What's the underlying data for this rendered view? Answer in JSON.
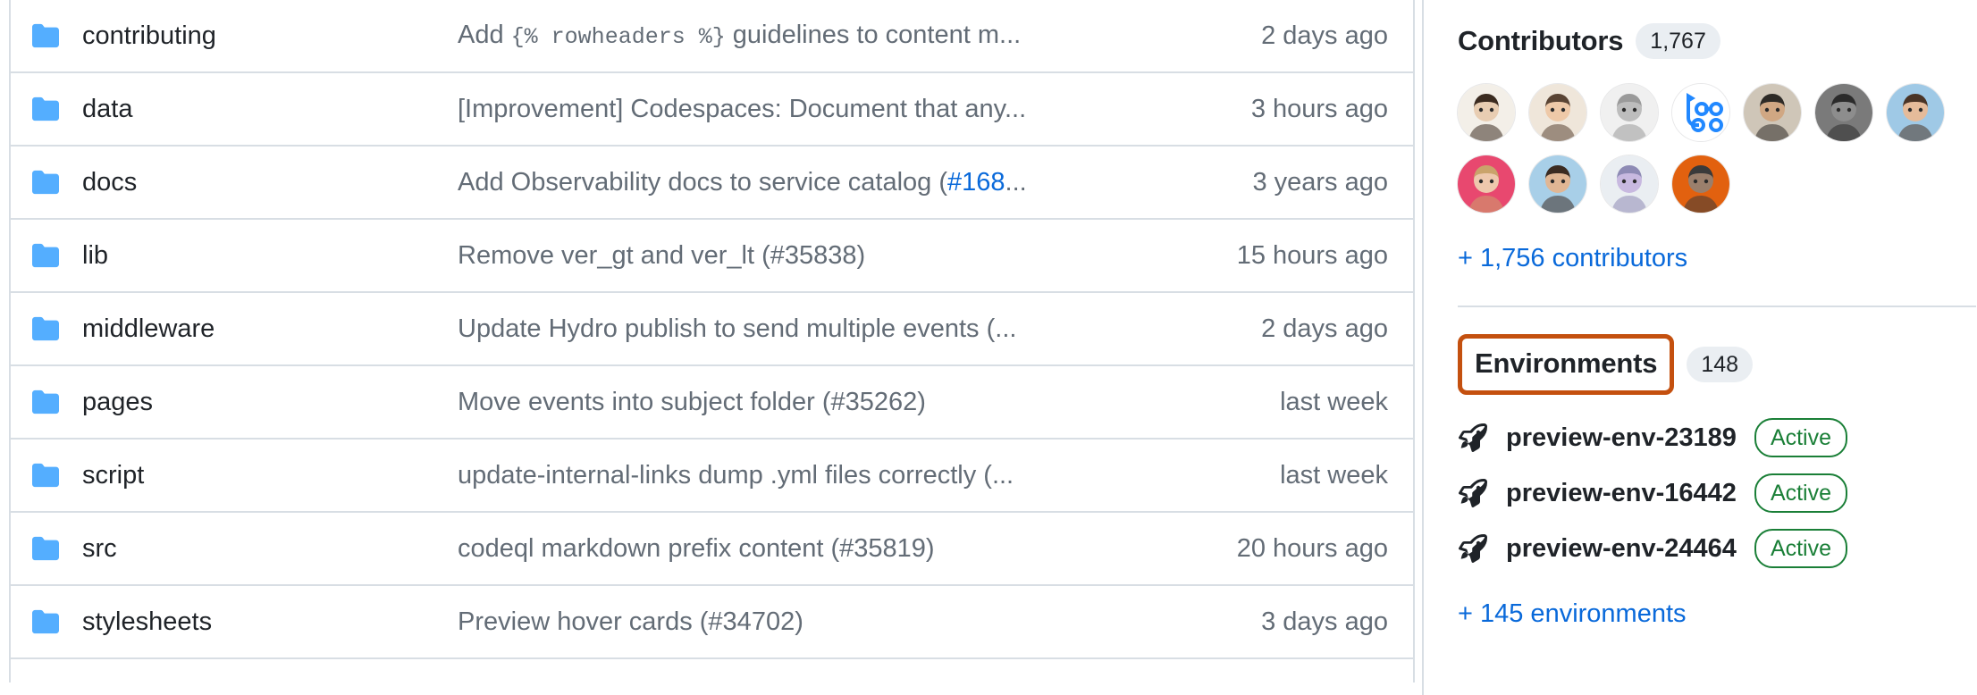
{
  "file_table": {
    "folder_icon_color": "#54aeff",
    "link_color": "#0969da",
    "rows": [
      {
        "name": "contributing",
        "icon": "folder-icon",
        "commit_pre": "Add ",
        "commit_code": "{% rowheaders %}",
        "commit_post": " guidelines to content m",
        "commit_link": "",
        "commit_tail": "",
        "truncated": "...",
        "date": "2 days ago"
      },
      {
        "name": "data",
        "icon": "folder-icon",
        "commit_pre": "[Improvement] Codespaces: Document that any",
        "commit_code": "",
        "commit_post": "",
        "commit_link": "",
        "commit_tail": "",
        "truncated": "...",
        "date": "3 hours ago"
      },
      {
        "name": "docs",
        "icon": "folder-icon",
        "commit_pre": "Add Observability docs to service catalog (",
        "commit_code": "",
        "commit_post": "",
        "commit_link": "#168",
        "commit_tail": "",
        "truncated": "...",
        "date": "3 years ago"
      },
      {
        "name": "lib",
        "icon": "folder-icon",
        "commit_pre": "Remove ver_gt and ver_lt (#35838)",
        "commit_code": "",
        "commit_post": "",
        "commit_link": "",
        "commit_tail": "",
        "truncated": "",
        "date": "15 hours ago"
      },
      {
        "name": "middleware",
        "icon": "folder-icon",
        "commit_pre": "Update Hydro publish to send multiple events (",
        "commit_code": "",
        "commit_post": "",
        "commit_link": "",
        "commit_tail": "",
        "truncated": "...",
        "date": "2 days ago"
      },
      {
        "name": "pages",
        "icon": "folder-icon",
        "commit_pre": "Move events into subject folder (#35262)",
        "commit_code": "",
        "commit_post": "",
        "commit_link": "",
        "commit_tail": "",
        "truncated": "",
        "date": "last week"
      },
      {
        "name": "script",
        "icon": "folder-icon",
        "commit_pre": "update-internal-links dump .yml files correctly (",
        "commit_code": "",
        "commit_post": "",
        "commit_link": "",
        "commit_tail": "",
        "truncated": "...",
        "date": "last week"
      },
      {
        "name": "src",
        "icon": "folder-icon",
        "commit_pre": "codeql markdown prefix content (#35819)",
        "commit_code": "",
        "commit_post": "",
        "commit_link": "",
        "commit_tail": "",
        "truncated": "",
        "date": "20 hours ago"
      },
      {
        "name": "stylesheets",
        "icon": "folder-icon",
        "commit_pre": "Preview hover cards (#34702)",
        "commit_code": "",
        "commit_post": "",
        "commit_link": "",
        "commit_tail": "",
        "truncated": "",
        "date": "3 days ago"
      }
    ]
  },
  "sidebar": {
    "contributors": {
      "title": "Contributors",
      "count": "1,767",
      "avatar_count": 11,
      "more_label": "+ 1,756 contributors"
    },
    "environments": {
      "title": "Environments",
      "count": "148",
      "highlight_color": "#C4500F",
      "items": [
        {
          "icon": "rocket-icon",
          "name": "preview-env-23189",
          "state": "Active",
          "state_color": "#1a7f37"
        },
        {
          "icon": "rocket-icon",
          "name": "preview-env-16442",
          "state": "Active",
          "state_color": "#1a7f37"
        },
        {
          "icon": "rocket-icon",
          "name": "preview-env-24464",
          "state": "Active",
          "state_color": "#1a7f37"
        }
      ],
      "more_label": "+ 145 environments"
    }
  }
}
